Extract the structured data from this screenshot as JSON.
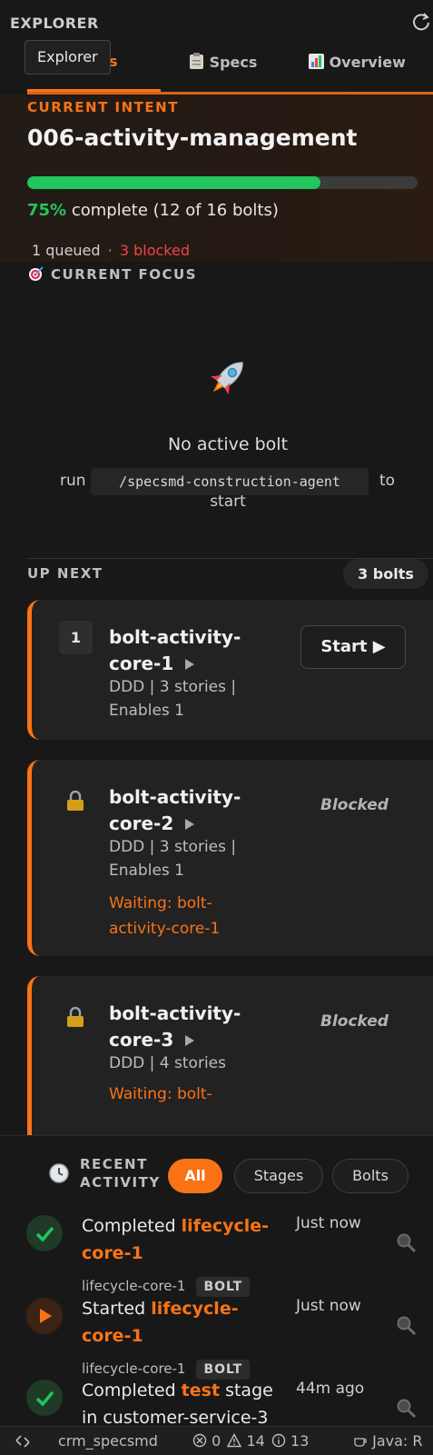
{
  "explorer": {
    "title": "EXPLORER",
    "tooltip": "Explorer"
  },
  "tabs": [
    {
      "label": "s",
      "icon": "bolts-tab",
      "active": true
    },
    {
      "label": "Specs",
      "icon": "clipboard-icon",
      "active": false
    },
    {
      "label": "Overview",
      "icon": "chart-icon",
      "active": false
    }
  ],
  "intent": {
    "label": "CURRENT INTENT",
    "title": "006-activity-management",
    "progress_fraction": 0.75,
    "progress_pct": "75%",
    "progress_rest": " complete (12 of 16 bolts)",
    "queued": "1 queued",
    "separator": "·",
    "blocked": "3 blocked"
  },
  "focus": {
    "label": "CURRENT FOCUS",
    "empty_title": "No active bolt",
    "run_prefix": "run",
    "command": "/specsmd-construction-agent",
    "run_to": "to",
    "run_suffix": "start"
  },
  "up_next": {
    "label": "UP NEXT",
    "badge": "3 bolts",
    "cards": [
      {
        "number": "1",
        "name_line1": "bolt-activity-",
        "name_line2": "core-1",
        "meta_line1": "DDD | 3 stories |",
        "meta_line2": "Enables 1",
        "action": "Start ▶"
      },
      {
        "name_line1": "bolt-activity-",
        "name_line2": "core-2",
        "meta_line1": "DDD | 3 stories |",
        "meta_line2": "Enables 1",
        "wait_line1": "Waiting: bolt-",
        "wait_line2": "activity-core-1",
        "status": "Blocked"
      },
      {
        "name_line1": "bolt-activity-",
        "name_line2": "core-3",
        "meta_line1": "DDD | 4 stories",
        "wait_line1": "Waiting: bolt-",
        "status": "Blocked"
      }
    ]
  },
  "recent": {
    "label_line1": "RECENT",
    "label_line2": "ACTIVITY",
    "filters": [
      "All",
      "Stages",
      "Bolts"
    ],
    "items": [
      {
        "prefix": "Completed ",
        "hl_line1": "lifecycle-",
        "hl_line2": "core-1",
        "time": "Just now",
        "sub": "lifecycle-core-1",
        "badge": "BOLT",
        "state": "completed"
      },
      {
        "prefix": "Started ",
        "hl_line1": "lifecycle-",
        "hl_line2": "core-1",
        "time": "Just now",
        "sub": "lifecycle-core-1",
        "badge": "BOLT",
        "state": "started"
      },
      {
        "prefix": "Completed ",
        "hl_line1": "test",
        "suffix": " stage",
        "line2": "in customer-service-3",
        "time": "44m ago",
        "state": "completed"
      }
    ]
  },
  "statusbar": {
    "repo": "crm_specsmd",
    "errors": "0",
    "warnings": "14",
    "info": "13",
    "java": "Java: R"
  },
  "colors": {
    "accent": "#f97316",
    "success": "#22c55e",
    "danger": "#ef4444"
  }
}
